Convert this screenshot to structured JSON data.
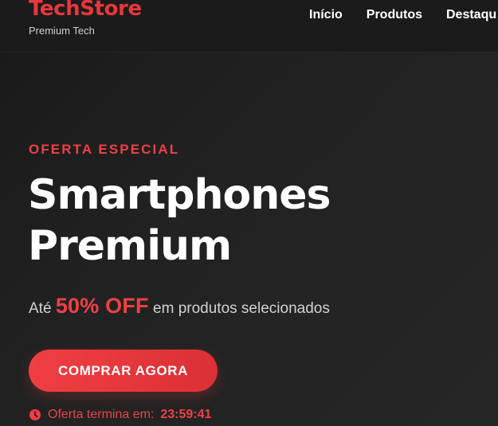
{
  "header": {
    "brand": "TechStore",
    "tagline": "Premium Tech",
    "nav": [
      {
        "label": "Início"
      },
      {
        "label": "Produtos"
      },
      {
        "label": "Destaqu"
      }
    ]
  },
  "hero": {
    "eyebrow": "OFERTA ESPECIAL",
    "title_line1": "Smartphones",
    "title_line2": "Premium",
    "offer_prefix": "Até",
    "offer_highlight": "50% OFF",
    "offer_suffix": "em produtos selecionados",
    "cta_label": "COMPRAR AGORA",
    "countdown_label": "Oferta termina em:",
    "countdown_time": "23:59:41"
  },
  "icons": {
    "clock": "clock-icon"
  },
  "colors": {
    "background": "#1e1e1e",
    "header_background": "#1b1b1b",
    "accent": "#ef4045",
    "text": "#ffffff",
    "muted_text": "#d2d2d2"
  }
}
